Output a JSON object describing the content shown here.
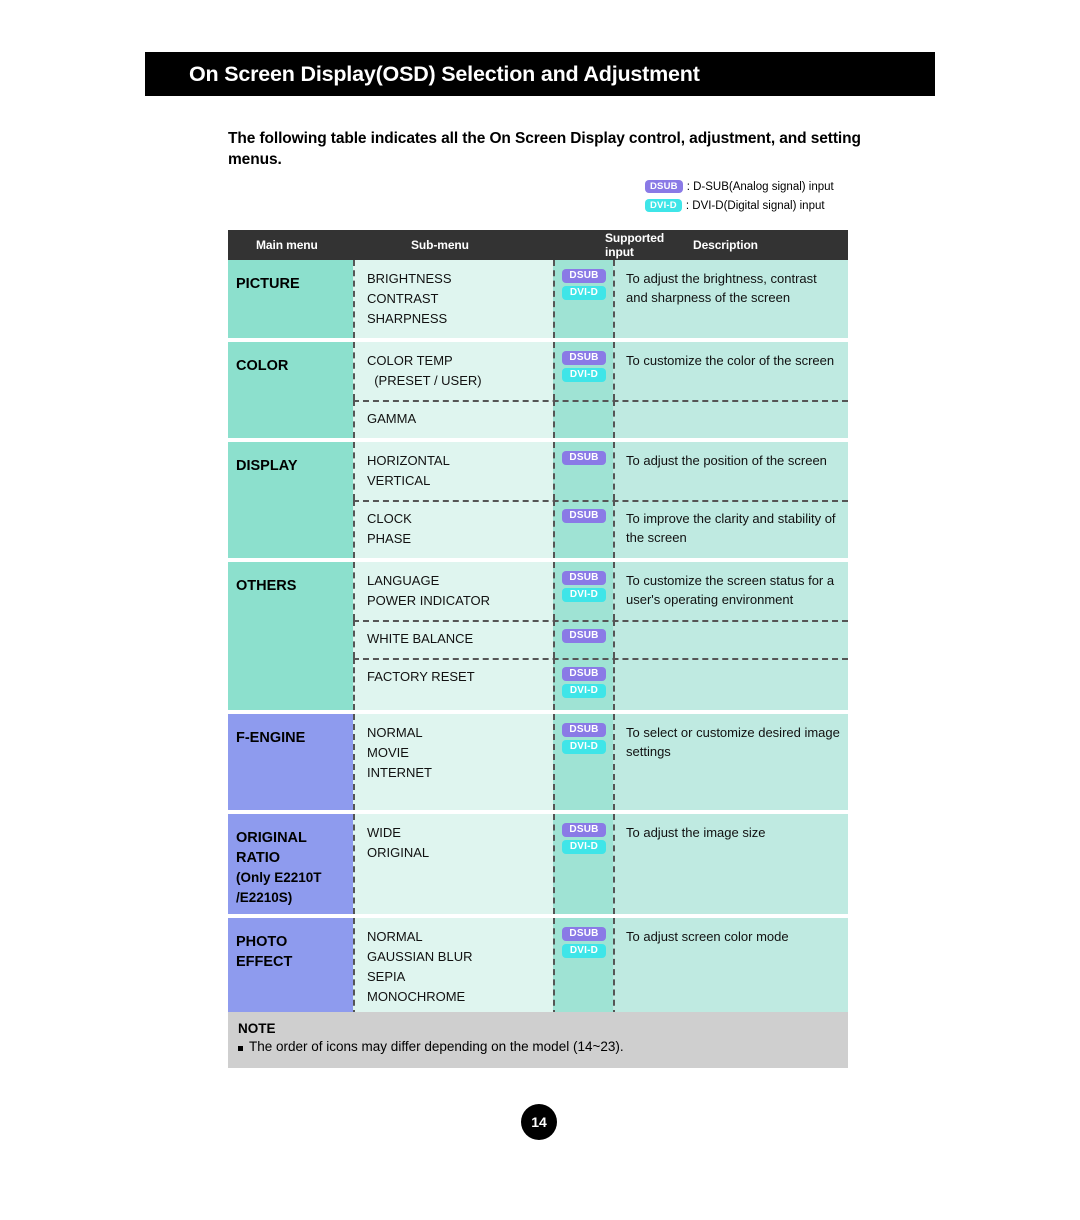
{
  "header": {
    "title": "On Screen Display(OSD) Selection and Adjustment"
  },
  "intro": {
    "text": "The following table indicates all the On Screen Display control, adjustment, and setting menus."
  },
  "legend": {
    "items": [
      {
        "badge": "DSUB",
        "badge_type": "dsub",
        "text": ": D-SUB(Analog signal) input"
      },
      {
        "badge": "DVI-D",
        "badge_type": "dvid",
        "text": ": DVI-D(Digital signal) input"
      }
    ]
  },
  "table": {
    "columns": [
      "Main menu",
      "Sub-menu",
      "Supported input",
      "Description"
    ],
    "rows": [
      {
        "menu": "PICTURE",
        "menu_note": "",
        "menu_color": "teal",
        "groups": [
          {
            "submenu": "BRIGHTNESS\nCONTRAST\nSHARPNESS",
            "inputs": [
              "DSUB",
              "DVI-D"
            ],
            "description": "To adjust the brightness, contrast and sharpness of the screen"
          }
        ]
      },
      {
        "menu": "COLOR",
        "menu_note": "",
        "menu_color": "teal",
        "groups": [
          {
            "submenu": "COLOR TEMP\n  (PRESET / USER)",
            "inputs": [
              "DSUB",
              "DVI-D"
            ],
            "description": "To customize the color of the screen"
          },
          {
            "submenu": "GAMMA",
            "inputs": [],
            "description": ""
          }
        ]
      },
      {
        "menu": "DISPLAY",
        "menu_note": "",
        "menu_color": "teal",
        "groups": [
          {
            "submenu": "HORIZONTAL\nVERTICAL",
            "inputs": [
              "DSUB"
            ],
            "description": "To adjust the position of the screen"
          },
          {
            "submenu": "CLOCK\nPHASE",
            "inputs": [
              "DSUB"
            ],
            "description": "To improve the clarity and stability of the screen"
          }
        ]
      },
      {
        "menu": "OTHERS",
        "menu_note": "",
        "menu_color": "teal",
        "groups": [
          {
            "submenu": "LANGUAGE\nPOWER INDICATOR",
            "inputs": [
              "DSUB",
              "DVI-D"
            ],
            "description": "To customize the screen status for a user's operating environment"
          },
          {
            "submenu": "WHITE BALANCE",
            "inputs": [
              "DSUB"
            ],
            "description": ""
          },
          {
            "submenu": "FACTORY RESET",
            "inputs": [
              "DSUB",
              "DVI-D"
            ],
            "description": ""
          }
        ]
      },
      {
        "menu": "F-ENGINE",
        "menu_note": "",
        "menu_color": "blue",
        "groups": [
          {
            "submenu": "NORMAL\nMOVIE\nINTERNET",
            "inputs": [
              "DSUB",
              "DVI-D"
            ],
            "description": "To select or customize desired image settings"
          }
        ]
      },
      {
        "menu": "ORIGINAL\nRATIO",
        "menu_note": "(Only E2210T\n/E2210S)",
        "menu_color": "blue",
        "groups": [
          {
            "submenu": "WIDE\nORIGINAL",
            "inputs": [
              "DSUB",
              "DVI-D"
            ],
            "description": "To adjust the image size"
          }
        ]
      },
      {
        "menu": "PHOTO\nEFFECT",
        "menu_note": "",
        "menu_color": "blue",
        "groups": [
          {
            "submenu": "NORMAL\nGAUSSIAN BLUR\nSEPIA\nMONOCHROME",
            "inputs": [
              "DSUB",
              "DVI-D"
            ],
            "description": "To adjust screen color mode"
          }
        ]
      }
    ]
  },
  "note": {
    "title": "NOTE",
    "line": "The order of icons may differ depending on the model (14~23)."
  },
  "page": {
    "number": "14"
  },
  "colors": {
    "dsub_badge": "#8a7ae6",
    "dvid_badge": "#3fe5e8",
    "menu_teal": "#8ce0cd",
    "menu_blue": "#8e9bee",
    "submenu_bg": "#dff5ef",
    "input_bg": "#9fe3d4",
    "desc_bg": "#bfeae1",
    "header_bg": "#333333",
    "note_bg": "#cfcfcf",
    "title_bg": "#000000"
  }
}
